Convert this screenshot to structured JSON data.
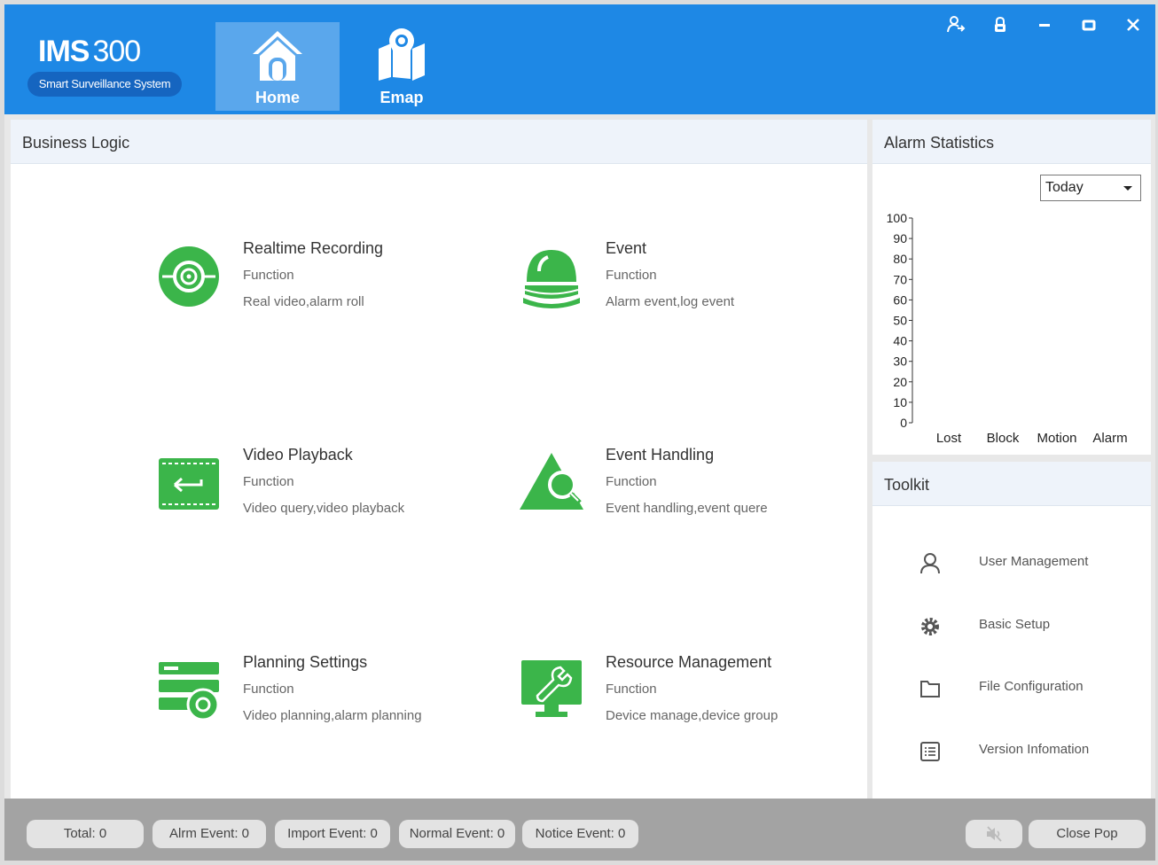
{
  "header": {
    "logo_main": "IMS",
    "logo_num": "300",
    "logo_tagline": "Smart Surveillance System",
    "nav": [
      {
        "label": "Home",
        "icon": "home-icon",
        "active": true
      },
      {
        "label": "Emap",
        "icon": "map-pin-icon",
        "active": false
      }
    ],
    "window_controls": [
      "user-switch-icon",
      "lock-icon",
      "minimize-icon",
      "maximize-icon",
      "close-icon"
    ],
    "accent_color": "#1e88e5"
  },
  "business": {
    "title": "Business Logic",
    "items": [
      {
        "title": "Realtime Recording",
        "sub": "Function",
        "desc": "Real video,alarm roll",
        "icon": "camera-lens-icon"
      },
      {
        "title": "Event",
        "sub": "Function",
        "desc": "Alarm event,log event",
        "icon": "alarm-light-icon"
      },
      {
        "title": "Video Playback",
        "sub": "Function",
        "desc": "Video query,video playback",
        "icon": "film-playback-icon"
      },
      {
        "title": "Event Handling",
        "sub": "Function",
        "desc": "Event handling,event quere",
        "icon": "warning-search-icon"
      },
      {
        "title": "Planning Settings",
        "sub": "Function",
        "desc": "Video planning,alarm planning",
        "icon": "planning-gear-icon"
      },
      {
        "title": "Resource Management",
        "sub": "Function",
        "desc": "Device manage,device group",
        "icon": "monitor-wrench-icon"
      }
    ],
    "icon_color": "#3bb54a"
  },
  "alarm": {
    "title": "Alarm Statistics",
    "period": "Today",
    "chart_data": {
      "type": "bar",
      "categories": [
        "Lost",
        "Block",
        "Motion",
        "Alarm"
      ],
      "values": [
        0,
        0,
        0,
        0
      ],
      "ylim": [
        0,
        100
      ],
      "yticks": [
        "100",
        "90",
        "80",
        "70",
        "60",
        "50",
        "40",
        "30",
        "20",
        "10",
        "0"
      ]
    }
  },
  "toolkit": {
    "title": "Toolkit",
    "items": [
      {
        "label": "User Management",
        "icon": "user-icon"
      },
      {
        "label": "Basic Setup",
        "icon": "gear-icon"
      },
      {
        "label": "File Configuration",
        "icon": "folder-icon"
      },
      {
        "label": "Version Infomation",
        "icon": "list-document-icon"
      }
    ]
  },
  "status": {
    "counts": [
      "Total: 0",
      "Alrm Event: 0",
      "Import Event: 0",
      "Normal Event: 0",
      "Notice Event: 0"
    ],
    "mute_icon": "mute-icon",
    "close_pop": "Close Pop"
  }
}
